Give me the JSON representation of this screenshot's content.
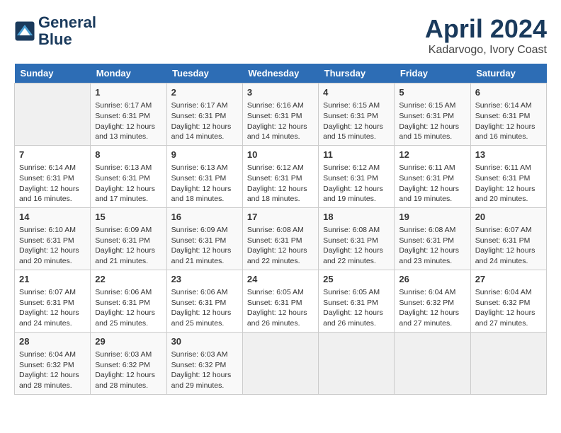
{
  "header": {
    "logo_line1": "General",
    "logo_line2": "Blue",
    "title": "April 2024",
    "location": "Kadarvogo, Ivory Coast"
  },
  "weekdays": [
    "Sunday",
    "Monday",
    "Tuesday",
    "Wednesday",
    "Thursday",
    "Friday",
    "Saturday"
  ],
  "weeks": [
    [
      {
        "day": "",
        "empty": true
      },
      {
        "day": "1",
        "rise": "Sunrise: 6:17 AM",
        "set": "Sunset: 6:31 PM",
        "daylight": "Daylight: 12 hours and 13 minutes."
      },
      {
        "day": "2",
        "rise": "Sunrise: 6:17 AM",
        "set": "Sunset: 6:31 PM",
        "daylight": "Daylight: 12 hours and 14 minutes."
      },
      {
        "day": "3",
        "rise": "Sunrise: 6:16 AM",
        "set": "Sunset: 6:31 PM",
        "daylight": "Daylight: 12 hours and 14 minutes."
      },
      {
        "day": "4",
        "rise": "Sunrise: 6:15 AM",
        "set": "Sunset: 6:31 PM",
        "daylight": "Daylight: 12 hours and 15 minutes."
      },
      {
        "day": "5",
        "rise": "Sunrise: 6:15 AM",
        "set": "Sunset: 6:31 PM",
        "daylight": "Daylight: 12 hours and 15 minutes."
      },
      {
        "day": "6",
        "rise": "Sunrise: 6:14 AM",
        "set": "Sunset: 6:31 PM",
        "daylight": "Daylight: 12 hours and 16 minutes."
      }
    ],
    [
      {
        "day": "7",
        "rise": "Sunrise: 6:14 AM",
        "set": "Sunset: 6:31 PM",
        "daylight": "Daylight: 12 hours and 16 minutes."
      },
      {
        "day": "8",
        "rise": "Sunrise: 6:13 AM",
        "set": "Sunset: 6:31 PM",
        "daylight": "Daylight: 12 hours and 17 minutes."
      },
      {
        "day": "9",
        "rise": "Sunrise: 6:13 AM",
        "set": "Sunset: 6:31 PM",
        "daylight": "Daylight: 12 hours and 18 minutes."
      },
      {
        "day": "10",
        "rise": "Sunrise: 6:12 AM",
        "set": "Sunset: 6:31 PM",
        "daylight": "Daylight: 12 hours and 18 minutes."
      },
      {
        "day": "11",
        "rise": "Sunrise: 6:12 AM",
        "set": "Sunset: 6:31 PM",
        "daylight": "Daylight: 12 hours and 19 minutes."
      },
      {
        "day": "12",
        "rise": "Sunrise: 6:11 AM",
        "set": "Sunset: 6:31 PM",
        "daylight": "Daylight: 12 hours and 19 minutes."
      },
      {
        "day": "13",
        "rise": "Sunrise: 6:11 AM",
        "set": "Sunset: 6:31 PM",
        "daylight": "Daylight: 12 hours and 20 minutes."
      }
    ],
    [
      {
        "day": "14",
        "rise": "Sunrise: 6:10 AM",
        "set": "Sunset: 6:31 PM",
        "daylight": "Daylight: 12 hours and 20 minutes."
      },
      {
        "day": "15",
        "rise": "Sunrise: 6:09 AM",
        "set": "Sunset: 6:31 PM",
        "daylight": "Daylight: 12 hours and 21 minutes."
      },
      {
        "day": "16",
        "rise": "Sunrise: 6:09 AM",
        "set": "Sunset: 6:31 PM",
        "daylight": "Daylight: 12 hours and 21 minutes."
      },
      {
        "day": "17",
        "rise": "Sunrise: 6:08 AM",
        "set": "Sunset: 6:31 PM",
        "daylight": "Daylight: 12 hours and 22 minutes."
      },
      {
        "day": "18",
        "rise": "Sunrise: 6:08 AM",
        "set": "Sunset: 6:31 PM",
        "daylight": "Daylight: 12 hours and 22 minutes."
      },
      {
        "day": "19",
        "rise": "Sunrise: 6:08 AM",
        "set": "Sunset: 6:31 PM",
        "daylight": "Daylight: 12 hours and 23 minutes."
      },
      {
        "day": "20",
        "rise": "Sunrise: 6:07 AM",
        "set": "Sunset: 6:31 PM",
        "daylight": "Daylight: 12 hours and 24 minutes."
      }
    ],
    [
      {
        "day": "21",
        "rise": "Sunrise: 6:07 AM",
        "set": "Sunset: 6:31 PM",
        "daylight": "Daylight: 12 hours and 24 minutes."
      },
      {
        "day": "22",
        "rise": "Sunrise: 6:06 AM",
        "set": "Sunset: 6:31 PM",
        "daylight": "Daylight: 12 hours and 25 minutes."
      },
      {
        "day": "23",
        "rise": "Sunrise: 6:06 AM",
        "set": "Sunset: 6:31 PM",
        "daylight": "Daylight: 12 hours and 25 minutes."
      },
      {
        "day": "24",
        "rise": "Sunrise: 6:05 AM",
        "set": "Sunset: 6:31 PM",
        "daylight": "Daylight: 12 hours and 26 minutes."
      },
      {
        "day": "25",
        "rise": "Sunrise: 6:05 AM",
        "set": "Sunset: 6:31 PM",
        "daylight": "Daylight: 12 hours and 26 minutes."
      },
      {
        "day": "26",
        "rise": "Sunrise: 6:04 AM",
        "set": "Sunset: 6:32 PM",
        "daylight": "Daylight: 12 hours and 27 minutes."
      },
      {
        "day": "27",
        "rise": "Sunrise: 6:04 AM",
        "set": "Sunset: 6:32 PM",
        "daylight": "Daylight: 12 hours and 27 minutes."
      }
    ],
    [
      {
        "day": "28",
        "rise": "Sunrise: 6:04 AM",
        "set": "Sunset: 6:32 PM",
        "daylight": "Daylight: 12 hours and 28 minutes."
      },
      {
        "day": "29",
        "rise": "Sunrise: 6:03 AM",
        "set": "Sunset: 6:32 PM",
        "daylight": "Daylight: 12 hours and 28 minutes."
      },
      {
        "day": "30",
        "rise": "Sunrise: 6:03 AM",
        "set": "Sunset: 6:32 PM",
        "daylight": "Daylight: 12 hours and 29 minutes."
      },
      {
        "day": "",
        "empty": true
      },
      {
        "day": "",
        "empty": true
      },
      {
        "day": "",
        "empty": true
      },
      {
        "day": "",
        "empty": true
      }
    ]
  ]
}
